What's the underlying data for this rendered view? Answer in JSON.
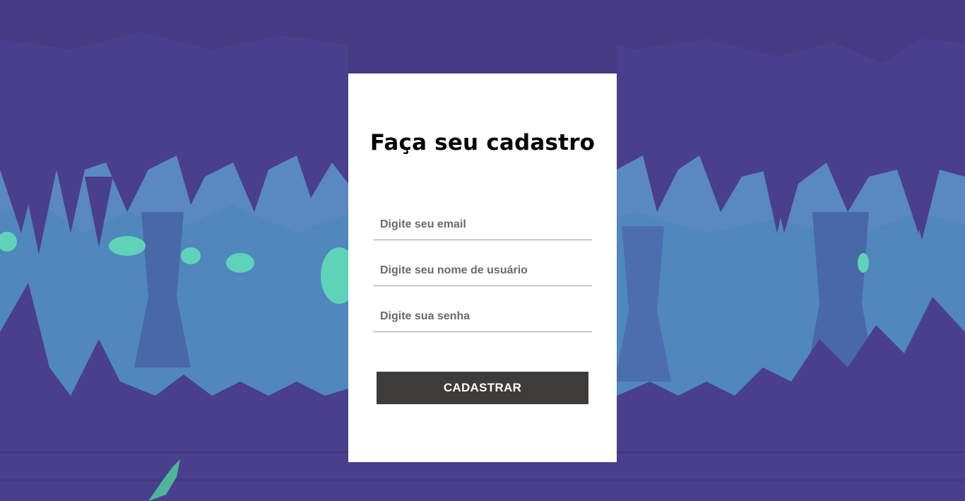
{
  "background": {
    "colors": {
      "cave_dark": "#463a82",
      "cave_mid": "#4a5ea6",
      "cave_light": "#5a88c0",
      "crystal": "#5ed3b8"
    }
  },
  "signup": {
    "title": "Faça seu cadastro",
    "email_placeholder": "Digite seu email",
    "email_value": "",
    "username_placeholder": "Digite seu nome de usuário",
    "username_value": "",
    "password_placeholder": "Digite sua senha",
    "password_value": "",
    "submit_label": "CADASTRAR"
  },
  "colors": {
    "card_background": "#ffffff",
    "button_background": "#3e3c3a",
    "button_text": "#ffffff",
    "title_text": "#050505"
  }
}
